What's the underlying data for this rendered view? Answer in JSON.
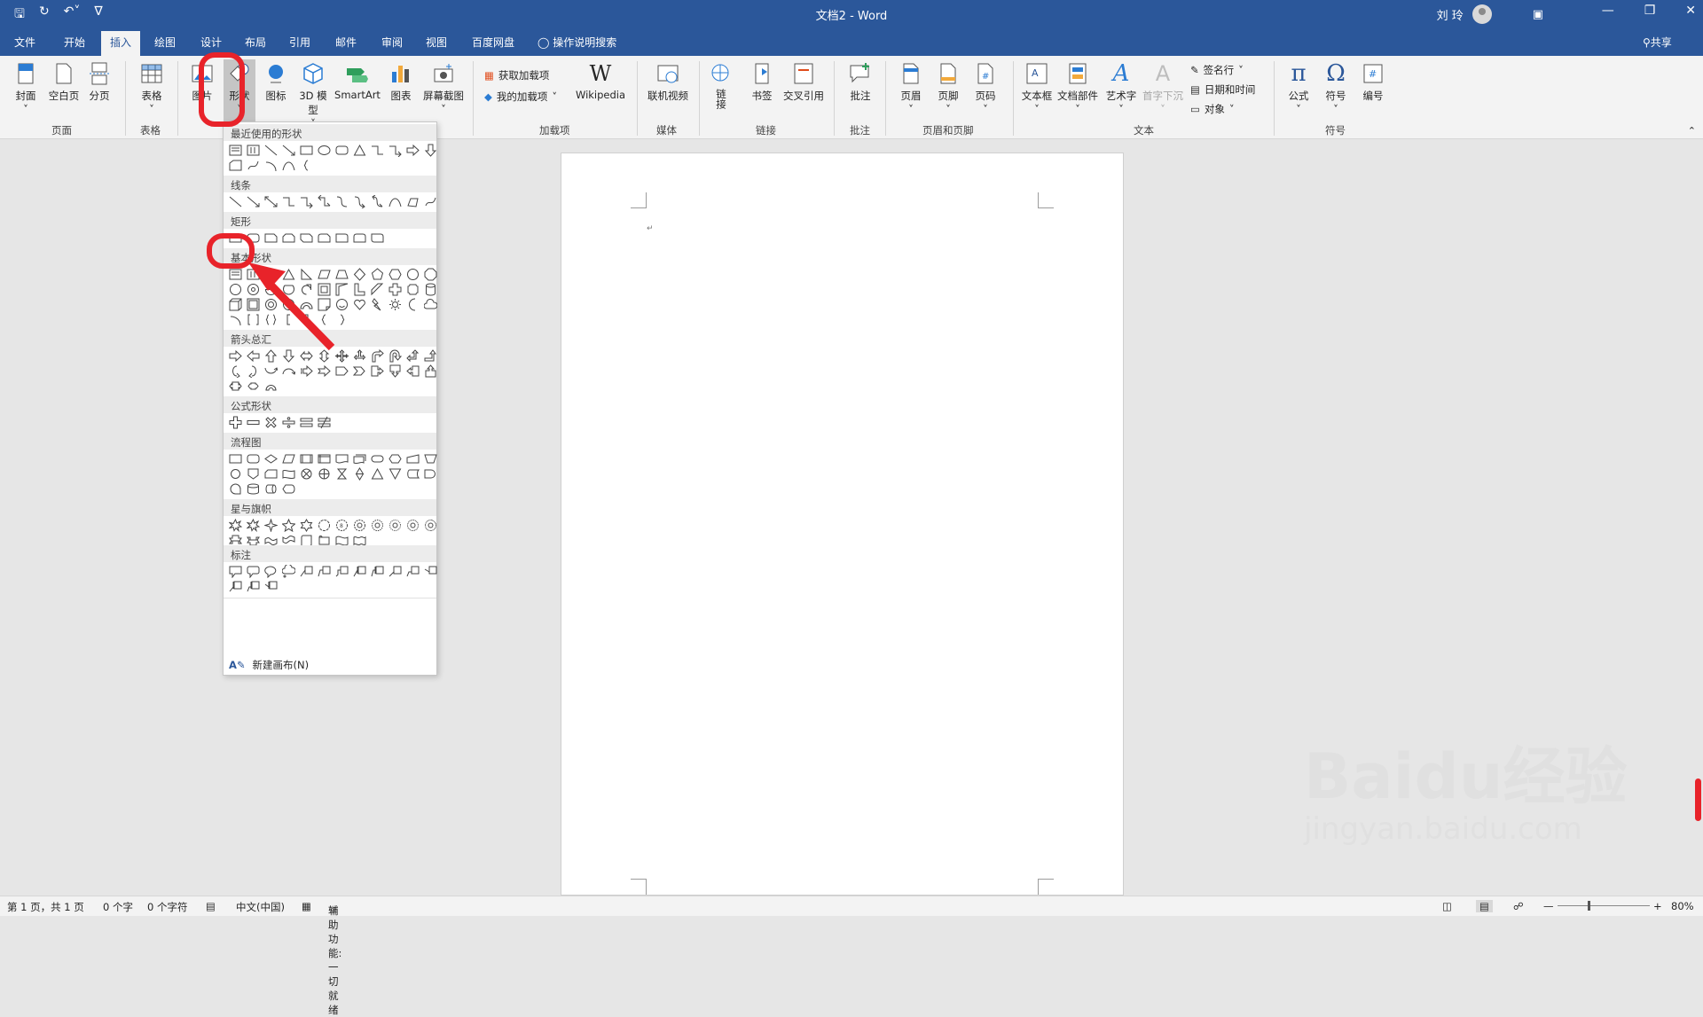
{
  "title_bar": {
    "title": "文档2  -  Word",
    "user": "刘 玲",
    "quick_access": [
      "save-icon",
      "autosave-icon",
      "undo-icon",
      "customize-icon"
    ]
  },
  "tabs": [
    "文件",
    "开始",
    "插入",
    "绘图",
    "设计",
    "布局",
    "引用",
    "邮件",
    "审阅",
    "视图",
    "百度网盘"
  ],
  "active_tab": "插入",
  "tell_me": "操作说明搜索",
  "share": "共享",
  "ribbon": {
    "buttons": {
      "cover": "封面",
      "blank": "空白页",
      "pagebreak": "分页",
      "table": "表格",
      "picture": "图片",
      "shapes": "形状",
      "icons": "图标",
      "model3d": "3D 模型",
      "smartart": "SmartArt",
      "chart": "图表",
      "screenshot": "屏幕截图",
      "get_addins": "获取加载项",
      "my_addins": "我的加载项",
      "wikipedia": "Wikipedia",
      "online_video": "联机视频",
      "link": "链接",
      "bookmark": "书签",
      "crossref": "交叉引用",
      "comment": "批注",
      "header": "页眉",
      "footer": "页脚",
      "pagenum": "页码",
      "textbox": "文本框",
      "quickparts": "文档部件",
      "wordart": "艺术字",
      "dropcap": "首字下沉",
      "signature": "签名行",
      "datetime": "日期和时间",
      "object": "对象",
      "equation": "公式",
      "symbol": "符号",
      "numbering": "编号"
    },
    "groups": {
      "pages": "页面",
      "tables": "表格",
      "addins": "加载项",
      "media": "媒体",
      "links": "链接",
      "comments": "批注",
      "header_footer": "页眉和页脚",
      "text": "文本",
      "symbols": "符号"
    }
  },
  "shapes_gallery": {
    "categories": {
      "recent": "最近使用的形状",
      "lines": "线条",
      "rect": "矩形",
      "basic": "基本形状",
      "arrows": "箭头总汇",
      "equation": "公式形状",
      "flowchart": "流程图",
      "stars": "星与旗帜",
      "callouts": "标注"
    },
    "new_canvas": "新建画布(N)"
  },
  "status_bar": {
    "page": "第 1 页，共 1 页",
    "words": "0 个字",
    "chars": "0 个字符",
    "language": "中文(中国)",
    "accessibility": "辅助功能: 一切就绪",
    "zoom": "80%"
  },
  "watermark": {
    "brand": "Baidu经验",
    "url": "jingyan.baidu.com"
  },
  "colors": {
    "accent": "#2b579a",
    "highlight": "#e8232a"
  }
}
